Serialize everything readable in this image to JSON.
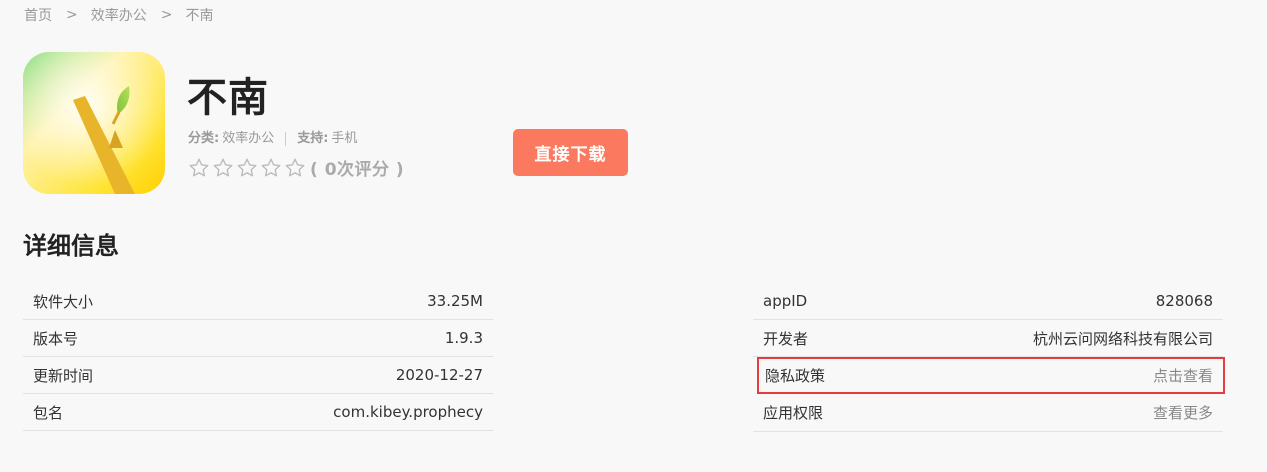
{
  "breadcrumb": {
    "home": "首页",
    "separator": ">",
    "category": "效率办公",
    "current": "不南"
  },
  "app": {
    "name": "不南",
    "icon": "sprout-app-icon",
    "category_key": "分类:",
    "category_value": "效率办公",
    "support_key": "支持:",
    "support_value": "手机",
    "rating_stars": 0,
    "rating_max": 5,
    "rating_text": "( 0次评分 )",
    "download_label": "直接下载"
  },
  "details": {
    "title": "详细信息",
    "left": [
      {
        "label": "软件大小",
        "value": "33.25M"
      },
      {
        "label": "版本号",
        "value": "1.9.3"
      },
      {
        "label": "更新时间",
        "value": "2020-12-27"
      },
      {
        "label": "包名",
        "value": "com.kibey.prophecy"
      }
    ],
    "right": [
      {
        "label": "appID",
        "value": "828068"
      },
      {
        "label": "开发者",
        "value": "杭州云问网络科技有限公司"
      },
      {
        "label": "隐私政策",
        "value": "点击查看"
      },
      {
        "label": "应用权限",
        "value": "查看更多"
      }
    ]
  },
  "colors": {
    "download_button": "#fb7a5f",
    "highlight_border": "#e83b3b",
    "background": "#f8f8f8"
  }
}
